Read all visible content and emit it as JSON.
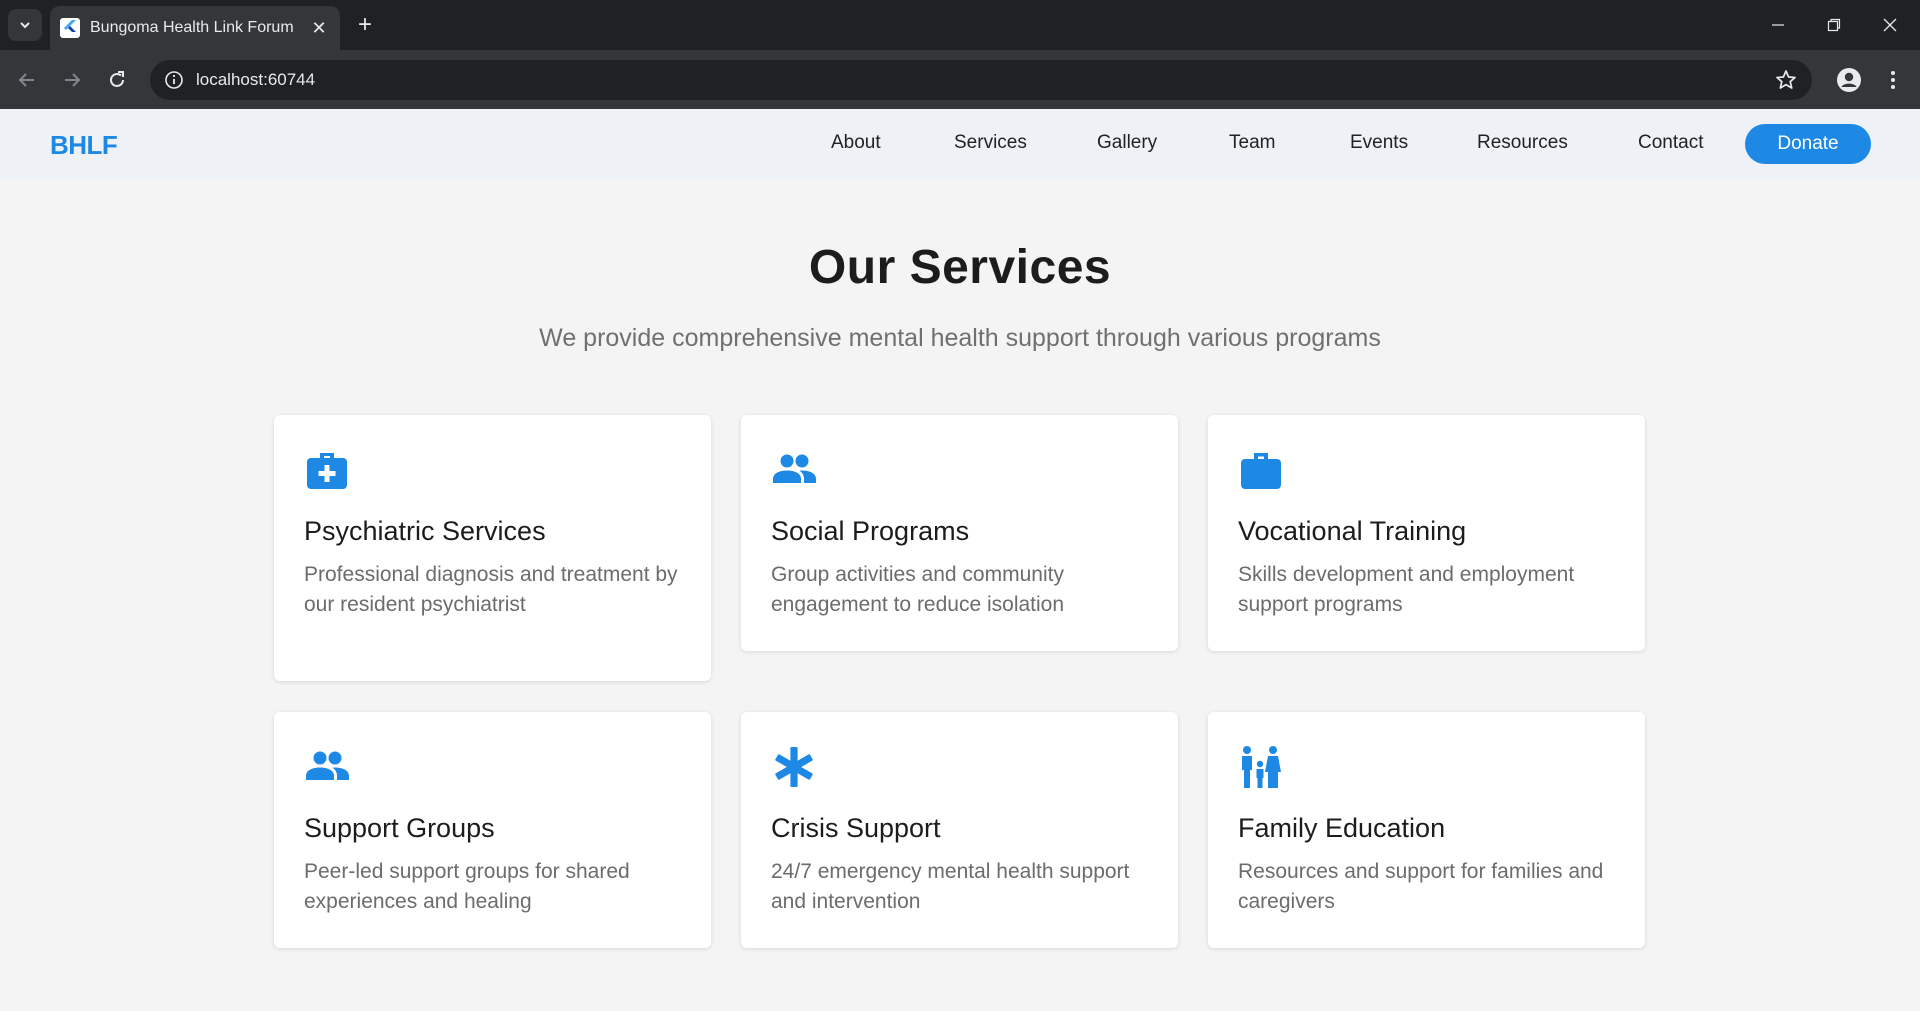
{
  "browser": {
    "tab_title": "Bungoma Health Link Forum",
    "url": "localhost:60744"
  },
  "site": {
    "logo": "BHLF",
    "nav": [
      "About",
      "Services",
      "Gallery",
      "Team",
      "Events",
      "Resources",
      "Contact"
    ],
    "donate_label": "Donate"
  },
  "services": {
    "title": "Our Services",
    "subtitle": "We provide comprehensive mental health support through various programs",
    "cards": [
      {
        "icon": "medical-kit-icon",
        "title": "Psychiatric Services",
        "description": "Professional diagnosis and treatment by our resident psychiatrist"
      },
      {
        "icon": "people-icon",
        "title": "Social Programs",
        "description": "Group activities and community engagement to reduce isolation"
      },
      {
        "icon": "briefcase-icon",
        "title": "Vocational Training",
        "description": "Skills development and employment support programs"
      },
      {
        "icon": "people-icon",
        "title": "Support Groups",
        "description": "Peer-led support groups for shared experiences and healing"
      },
      {
        "icon": "asterisk-icon",
        "title": "Crisis Support",
        "description": "24/7 emergency mental health support and intervention"
      },
      {
        "icon": "family-icon",
        "title": "Family Education",
        "description": "Resources and support for families and caregivers"
      }
    ]
  },
  "colors": {
    "accent": "#1e88e5",
    "nav_bg": "#eef2f7",
    "page_bg": "#f4f4f4"
  }
}
